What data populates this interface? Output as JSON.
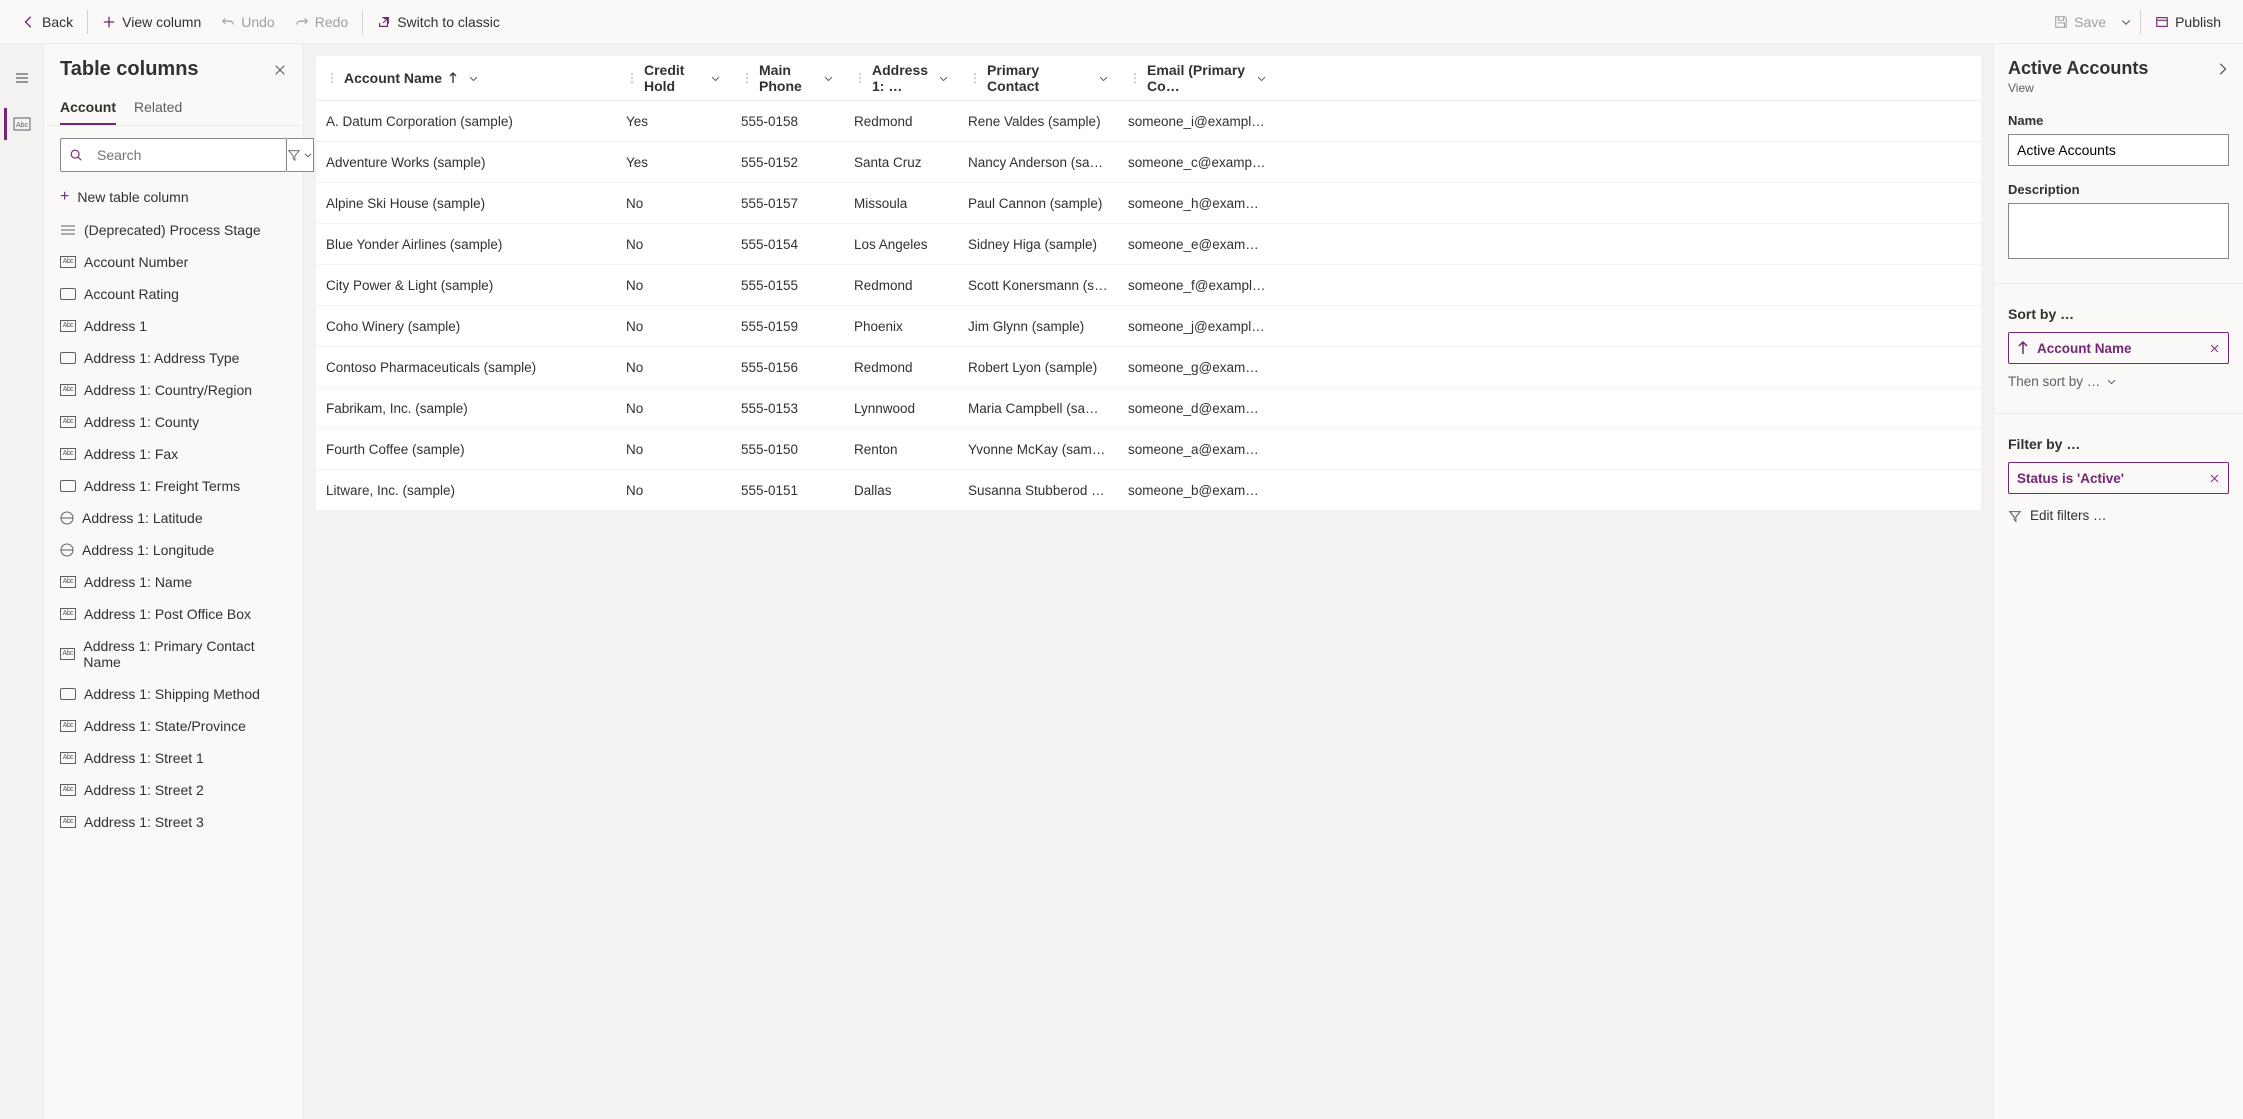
{
  "toolbar": {
    "back": "Back",
    "view_column": "View column",
    "undo": "Undo",
    "redo": "Redo",
    "switch_classic": "Switch to classic",
    "save": "Save",
    "publish": "Publish"
  },
  "columns_panel": {
    "title": "Table columns",
    "tabs": {
      "account": "Account",
      "related": "Related"
    },
    "search_placeholder": "Search",
    "new_column": "New table column",
    "items": [
      {
        "label": "(Deprecated) Process Stage",
        "type": "list"
      },
      {
        "label": "Account Number",
        "type": "text"
      },
      {
        "label": "Account Rating",
        "type": "option"
      },
      {
        "label": "Address 1",
        "type": "text"
      },
      {
        "label": "Address 1: Address Type",
        "type": "option"
      },
      {
        "label": "Address 1: Country/Region",
        "type": "text"
      },
      {
        "label": "Address 1: County",
        "type": "text"
      },
      {
        "label": "Address 1: Fax",
        "type": "text"
      },
      {
        "label": "Address 1: Freight Terms",
        "type": "option"
      },
      {
        "label": "Address 1: Latitude",
        "type": "geo"
      },
      {
        "label": "Address 1: Longitude",
        "type": "geo"
      },
      {
        "label": "Address 1: Name",
        "type": "text"
      },
      {
        "label": "Address 1: Post Office Box",
        "type": "text"
      },
      {
        "label": "Address 1: Primary Contact Name",
        "type": "text"
      },
      {
        "label": "Address 1: Shipping Method",
        "type": "option"
      },
      {
        "label": "Address 1: State/Province",
        "type": "text"
      },
      {
        "label": "Address 1: Street 1",
        "type": "text"
      },
      {
        "label": "Address 1: Street 2",
        "type": "text"
      },
      {
        "label": "Address 1: Street 3",
        "type": "text"
      }
    ]
  },
  "grid": {
    "headers": [
      "Account Name",
      "Credit Hold",
      "Main Phone",
      "Address 1: …",
      "Primary Contact",
      "Email (Primary Co…"
    ],
    "sorted_asc_index": 0,
    "rows": [
      {
        "name": "A. Datum Corporation (sample)",
        "credit": "Yes",
        "phone": "555-0158",
        "city": "Redmond",
        "contact": "Rene Valdes (sample)",
        "email": "someone_i@example.com"
      },
      {
        "name": "Adventure Works (sample)",
        "credit": "Yes",
        "phone": "555-0152",
        "city": "Santa Cruz",
        "contact": "Nancy Anderson (sample)",
        "email": "someone_c@example.com"
      },
      {
        "name": "Alpine Ski House (sample)",
        "credit": "No",
        "phone": "555-0157",
        "city": "Missoula",
        "contact": "Paul Cannon (sample)",
        "email": "someone_h@example.com"
      },
      {
        "name": "Blue Yonder Airlines (sample)",
        "credit": "No",
        "phone": "555-0154",
        "city": "Los Angeles",
        "contact": "Sidney Higa (sample)",
        "email": "someone_e@example.com"
      },
      {
        "name": "City Power & Light (sample)",
        "credit": "No",
        "phone": "555-0155",
        "city": "Redmond",
        "contact": "Scott Konersmann (sample)",
        "email": "someone_f@example.com"
      },
      {
        "name": "Coho Winery (sample)",
        "credit": "No",
        "phone": "555-0159",
        "city": "Phoenix",
        "contact": "Jim Glynn (sample)",
        "email": "someone_j@example.com"
      },
      {
        "name": "Contoso Pharmaceuticals (sample)",
        "credit": "No",
        "phone": "555-0156",
        "city": "Redmond",
        "contact": "Robert Lyon (sample)",
        "email": "someone_g@example.com"
      },
      {
        "name": "Fabrikam, Inc. (sample)",
        "credit": "No",
        "phone": "555-0153",
        "city": "Lynnwood",
        "contact": "Maria Campbell (sample)",
        "email": "someone_d@example.com"
      },
      {
        "name": "Fourth Coffee (sample)",
        "credit": "No",
        "phone": "555-0150",
        "city": "Renton",
        "contact": "Yvonne McKay (sample)",
        "email": "someone_a@example.com"
      },
      {
        "name": "Litware, Inc. (sample)",
        "credit": "No",
        "phone": "555-0151",
        "city": "Dallas",
        "contact": "Susanna Stubberod (sampl...",
        "email": "someone_b@example.com"
      }
    ]
  },
  "right_panel": {
    "title": "Active Accounts",
    "subtitle": "View",
    "name_label": "Name",
    "name_value": "Active Accounts",
    "description_label": "Description",
    "description_value": "",
    "sort_by_label": "Sort by …",
    "sort_field": "Account Name",
    "then_sort_label": "Then sort by …",
    "filter_by_label": "Filter by …",
    "filter_chip": "Status is 'Active'",
    "edit_filters": "Edit filters …"
  }
}
